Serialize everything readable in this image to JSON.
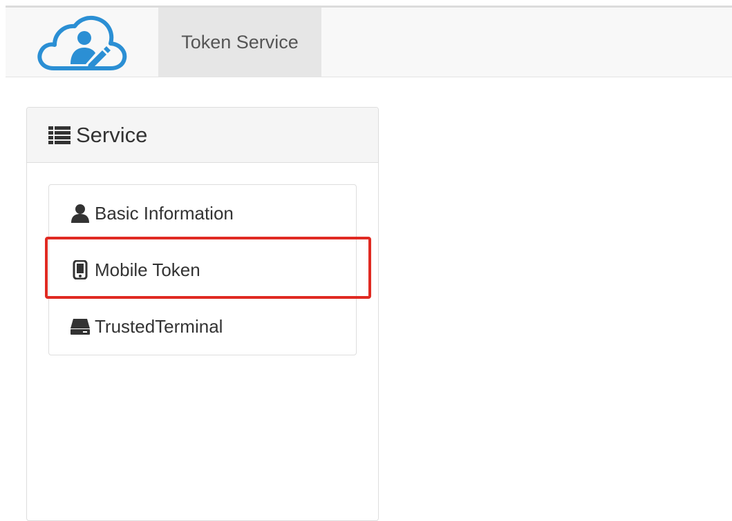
{
  "navbar": {
    "logo_icon": "cloud-user-edit-icon",
    "brand_color": "#2b8fd4",
    "tab_label": "Token Service"
  },
  "panel": {
    "heading_icon": "list-icon",
    "heading": "Service",
    "items": [
      {
        "icon": "user-icon",
        "label": "Basic Information"
      },
      {
        "icon": "mobile-icon",
        "label": "Mobile Token"
      },
      {
        "icon": "hdd-icon",
        "label": "TrustedTerminal"
      }
    ]
  },
  "annotation": {
    "highlight_color": "#e02a22",
    "highlighted_item": "Mobile Token"
  }
}
